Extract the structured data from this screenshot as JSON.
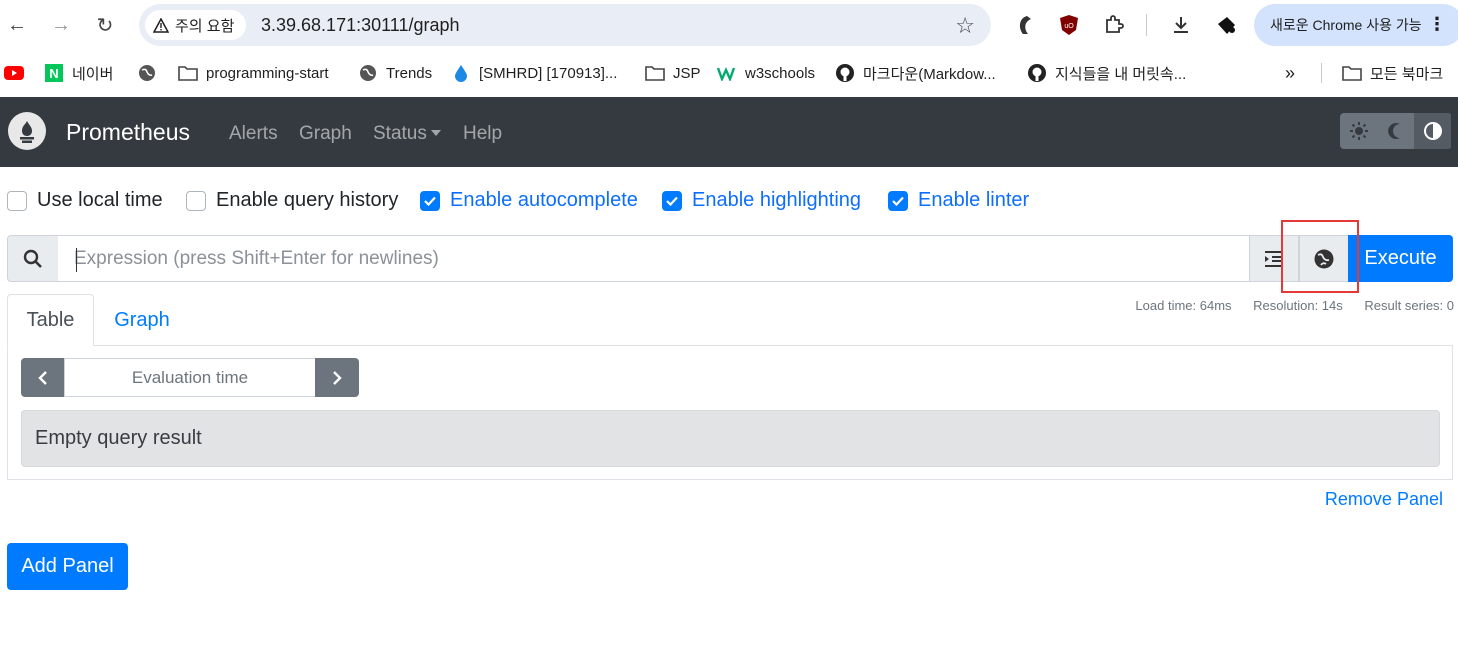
{
  "browser": {
    "security_label": "주의 요함",
    "url": "3.39.68.171:30111/graph",
    "update_label": "새로운 Chrome 사용 가능",
    "bookmarks": [
      {
        "icon": "youtube-icon",
        "label": ""
      },
      {
        "icon": "naver-icon",
        "label": "네이버"
      },
      {
        "icon": "globe-icon",
        "label": ""
      },
      {
        "icon": "folder-icon",
        "label": "programming-start"
      },
      {
        "icon": "globe-icon",
        "label": "Trends"
      },
      {
        "icon": "drop-icon",
        "label": "[SMHRD] [170913]..."
      },
      {
        "icon": "folder-icon",
        "label": "JSP"
      },
      {
        "icon": "w3schools-icon",
        "label": "w3schools"
      },
      {
        "icon": "github-icon",
        "label": "마크다운(Markdow..."
      },
      {
        "icon": "github-icon",
        "label": "지식들을 내 머릿속..."
      },
      {
        "icon": "overflow-chevron-icon",
        "label": "»"
      },
      {
        "icon": "folder-icon",
        "label": "모든 북마크"
      }
    ]
  },
  "navbar": {
    "brand": "Prometheus",
    "links": [
      "Alerts",
      "Graph",
      "Status",
      "Help"
    ]
  },
  "options": [
    {
      "label": "Use local time",
      "checked": false
    },
    {
      "label": "Enable query history",
      "checked": false
    },
    {
      "label": "Enable autocomplete",
      "checked": true
    },
    {
      "label": "Enable highlighting",
      "checked": true
    },
    {
      "label": "Enable linter",
      "checked": true
    }
  ],
  "query": {
    "placeholder": "Expression (press Shift+Enter for newlines)",
    "execute_label": "Execute"
  },
  "stats": {
    "load_time": "Load time: 64ms",
    "resolution": "Resolution: 14s",
    "result_series": "Result series: 0"
  },
  "tabs": [
    "Table",
    "Graph"
  ],
  "panel": {
    "eval_placeholder": "Evaluation time",
    "empty_message": "Empty query result",
    "remove_label": "Remove Panel"
  },
  "add_panel_label": "Add Panel",
  "colors": {
    "navbar": "#343a40",
    "primary": "#007bff",
    "highlight": "#e53935"
  }
}
